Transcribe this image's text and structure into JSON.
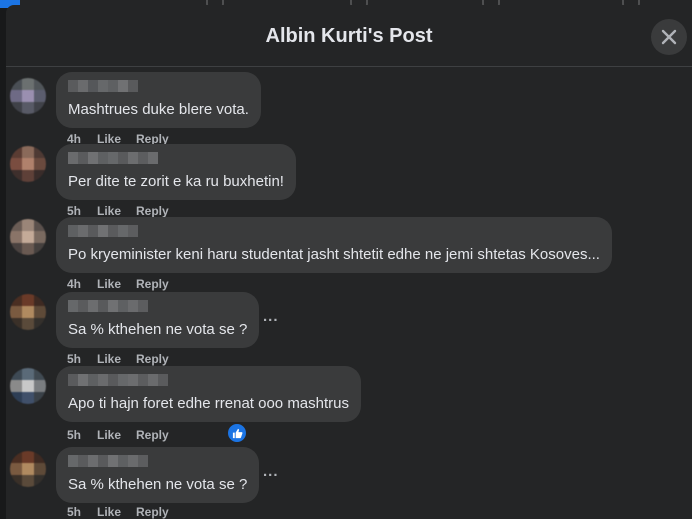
{
  "modal": {
    "title": "Albin Kurti's Post"
  },
  "comments": [
    {
      "text": "Mashtrues duke blere vota.",
      "time": "4h",
      "like": "Like",
      "reply": "Reply"
    },
    {
      "text": "Per dite te zorit e ka ru buxhetin!",
      "time": "5h",
      "like": "Like",
      "reply": "Reply"
    },
    {
      "text": "Po kryeminister keni haru studentat jasht shtetit edhe ne jemi shtetas Kosoves...",
      "time": "4h",
      "like": "Like",
      "reply": "Reply"
    },
    {
      "text": "Sa % kthehen ne vota se ?",
      "time": "5h",
      "like": "Like",
      "reply": "Reply",
      "more": "..."
    },
    {
      "text": "Apo ti hajn foret edhe rrenat ooo mashtrus",
      "time": "5h",
      "like": "Like",
      "reply": "Reply",
      "reaction": "like-reaction-icon"
    },
    {
      "text": "Sa % kthehen ne vota se ?",
      "time": "5h",
      "like": "Like",
      "reply": "Reply",
      "more": "..."
    }
  ],
  "colors": {
    "background": "#18191a",
    "surface": "#242526",
    "bubble": "#3a3b3c",
    "text": "#e4e6eb",
    "secondary_text": "#b0b3b8",
    "accent": "#1b74e4"
  }
}
